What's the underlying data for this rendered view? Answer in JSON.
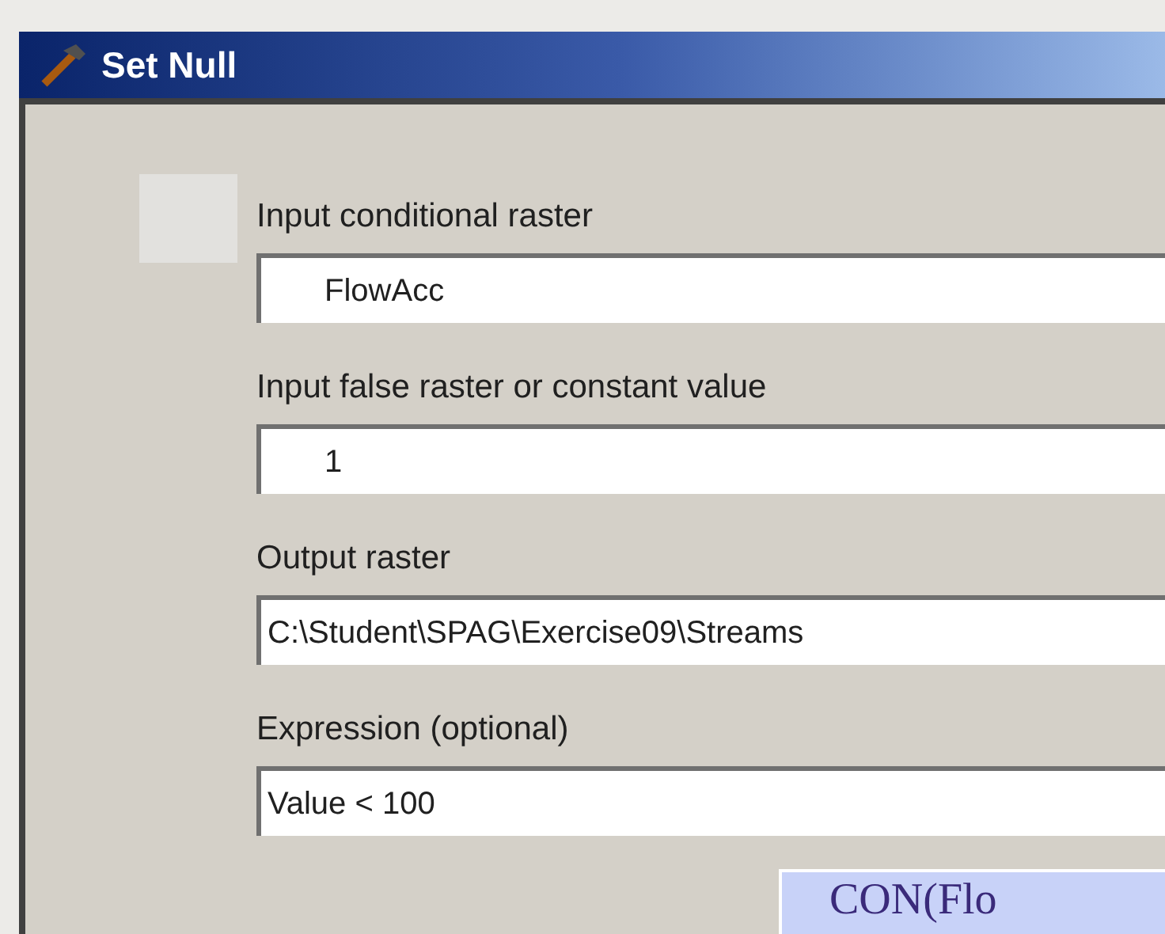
{
  "window": {
    "title": "Set Null"
  },
  "fields": [
    {
      "label": "Input conditional raster",
      "value": "FlowAcc",
      "kind": "dropdown"
    },
    {
      "label": "Input false raster or constant value",
      "value": "1",
      "kind": "dropdown"
    },
    {
      "label": "Output raster",
      "value": "C:\\Student\\SPAG\\Exercise09\\Streams",
      "kind": "text"
    },
    {
      "label": "Expression (optional)",
      "value": "Value < 100",
      "kind": "text"
    }
  ],
  "overlay": {
    "text": "CON(Flo"
  }
}
